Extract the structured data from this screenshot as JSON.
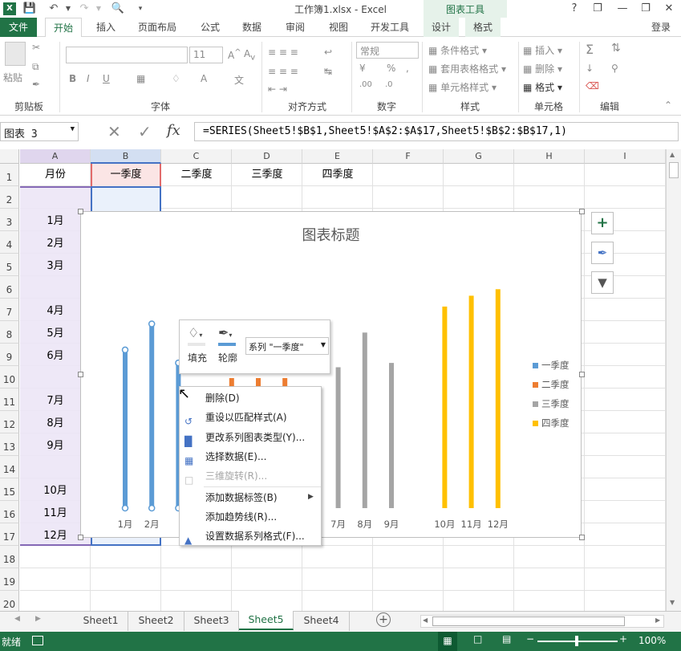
{
  "titlebar": {
    "title": "工作簿1.xlsx - Excel",
    "help": "?",
    "min": "—",
    "restore": "❐",
    "close": "✕"
  },
  "ribbon_tabs": {
    "file": "文件",
    "home": "开始",
    "insert": "插入",
    "layout": "页面布局",
    "formulas": "公式",
    "data": "数据",
    "review": "审阅",
    "view": "视图",
    "developer": "开发工具",
    "chart_tools": "图表工具",
    "design": "设计",
    "format": "格式",
    "login": "登录"
  },
  "ribbon": {
    "clipboard": {
      "paste": "粘贴",
      "label": "剪贴板"
    },
    "font": {
      "size": "11",
      "label": "字体"
    },
    "align": {
      "label": "对齐方式"
    },
    "number": {
      "format": "常规",
      "label": "数字"
    },
    "styles": {
      "cond": "条件格式",
      "table": "套用表格格式",
      "cell": "单元格样式",
      "label": "样式"
    },
    "cells": {
      "insert": "插入",
      "delete": "删除",
      "format": "格式",
      "label": "单元格"
    },
    "edit": {
      "label": "编辑"
    }
  },
  "formula_bar": {
    "name_box": "图表 3",
    "formula": "=SERIES(Sheet5!$B$1,Sheet5!$A$2:$A$17,Sheet5!$B$2:$B$17,1)"
  },
  "columns": [
    "A",
    "B",
    "C",
    "D",
    "E",
    "F",
    "G",
    "H",
    "I"
  ],
  "rows": [
    "1",
    "2",
    "3",
    "4",
    "5",
    "6",
    "7",
    "8",
    "9",
    "10",
    "11",
    "12",
    "13",
    "14",
    "15",
    "16",
    "17",
    "18",
    "19",
    "20"
  ],
  "headers_row": {
    "a": "月份",
    "b": "一季度",
    "c": "二季度",
    "d": "三季度",
    "e": "四季度"
  },
  "col_a": [
    "",
    "1月",
    "2月",
    "3月",
    "",
    "4月",
    "5月",
    "6月",
    "",
    "7月",
    "8月",
    "9月",
    "",
    "10月",
    "11月",
    "12月"
  ],
  "chart": {
    "title": "图表标题",
    "legend": [
      {
        "name": "一季度",
        "color": "#5b9bd5"
      },
      {
        "name": "二季度",
        "color": "#ed7d31"
      },
      {
        "name": "三季度",
        "color": "#a5a5a5"
      },
      {
        "name": "四季度",
        "color": "#ffc000"
      }
    ],
    "visible_x_labels": [
      "1月",
      "2月",
      "7月",
      "8月",
      "9月",
      "10月",
      "11月",
      "12月"
    ]
  },
  "chart_data": {
    "type": "bar",
    "title": "图表标题",
    "categories": [
      "1月",
      "2月",
      "3月",
      "",
      "4月",
      "5月",
      "6月",
      "",
      "7月",
      "8月",
      "9月",
      "",
      "10月",
      "11月",
      "12月"
    ],
    "series": [
      {
        "name": "一季度",
        "values": [
          73,
          85,
          67,
          null,
          null,
          null,
          null,
          null,
          null,
          null,
          null,
          null,
          null,
          null,
          null
        ]
      },
      {
        "name": "二季度",
        "values": [
          null,
          null,
          null,
          null,
          60,
          60,
          60,
          null,
          null,
          null,
          null,
          null,
          null,
          null,
          null
        ]
      },
      {
        "name": "三季度",
        "values": [
          null,
          null,
          null,
          null,
          null,
          null,
          null,
          null,
          65,
          81,
          67,
          null,
          null,
          null,
          null
        ]
      },
      {
        "name": "四季度",
        "values": [
          null,
          null,
          null,
          null,
          null,
          null,
          null,
          null,
          null,
          null,
          null,
          null,
          93,
          98,
          101
        ]
      }
    ]
  },
  "mini_toolbar": {
    "fill": "填充",
    "outline": "轮廓",
    "series_select": "系列 \"一季度\""
  },
  "context_menu": [
    {
      "label": "删除(D)",
      "disabled": false
    },
    {
      "label": "重设以匹配样式(A)",
      "disabled": false
    },
    {
      "label": "更改系列图表类型(Y)...",
      "disabled": false
    },
    {
      "label": "选择数据(E)...",
      "disabled": false
    },
    {
      "label": "三维旋转(R)...",
      "disabled": true
    },
    {
      "label": "添加数据标签(B)",
      "disabled": false
    },
    {
      "label": "添加趋势线(R)...",
      "disabled": false
    },
    {
      "label": "设置数据系列格式(F)...",
      "disabled": false
    }
  ],
  "sheets": [
    "Sheet1",
    "Sheet2",
    "Sheet3",
    "Sheet5",
    "Sheet4"
  ],
  "active_sheet": "Sheet5",
  "status": {
    "ready": "就绪",
    "zoom": "100%"
  },
  "colors": {
    "excel_green": "#217346",
    "selection_border": "#4472c4",
    "col_a_fill": "#ede6f7"
  }
}
